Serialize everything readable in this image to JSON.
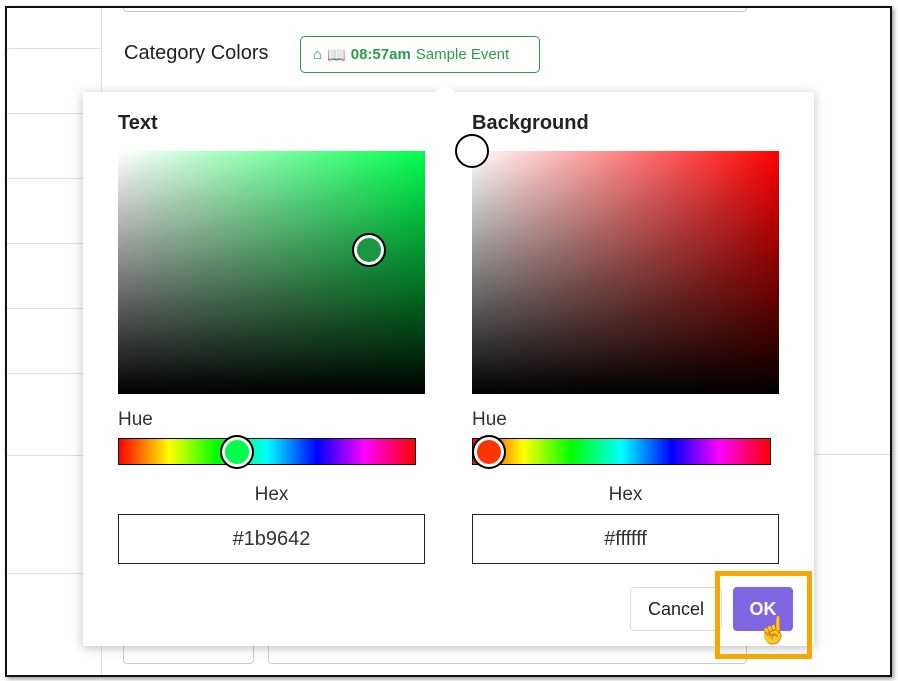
{
  "header": {
    "label": "Category Colors",
    "chip": {
      "time": "08:57am",
      "title": "Sample Event",
      "icons": [
        "home-icon",
        "book-icon"
      ],
      "color": "#2e9a4a"
    }
  },
  "picker": {
    "text": {
      "title": "Text",
      "hue_label": "Hue",
      "hex_label": "Hex",
      "hex_value": "#1b9642",
      "hue_color": "#00ff4c"
    },
    "background": {
      "title": "Background",
      "hue_label": "Hue",
      "hex_label": "Hex",
      "hex_value": "#ffffff",
      "hue_color": "#ff0000"
    },
    "cancel_label": "Cancel",
    "ok_label": "OK",
    "ok_color": "#8066e0"
  }
}
